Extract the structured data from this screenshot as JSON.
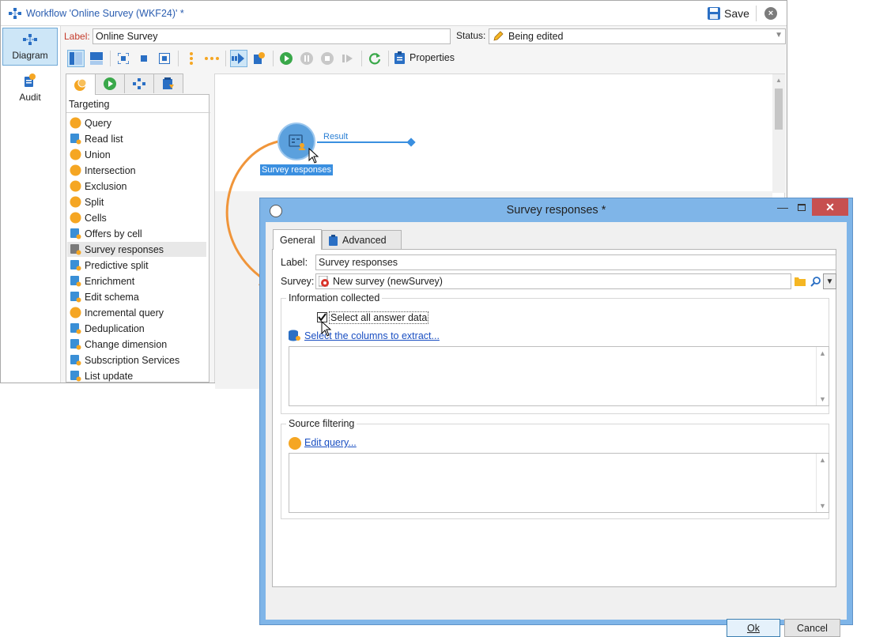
{
  "workflow": {
    "title": "Workflow 'Online Survey (WKF24)' *",
    "save_label": "Save",
    "label_caption": "Label:",
    "label_value": "Online Survey",
    "status_caption": "Status:",
    "status_value": "Being edited",
    "properties_label": "Properties"
  },
  "nav": {
    "diagram": "Diagram",
    "audit": "Audit"
  },
  "palette": {
    "header": "Targeting",
    "items": [
      {
        "label": "Query",
        "icon": "query-icon",
        "color": "#f5a623"
      },
      {
        "label": "Read list",
        "icon": "read-list-icon",
        "color": "#3a8fd6"
      },
      {
        "label": "Union",
        "icon": "union-icon",
        "color": "#f5a623"
      },
      {
        "label": "Intersection",
        "icon": "intersection-icon",
        "color": "#f5a623"
      },
      {
        "label": "Exclusion",
        "icon": "exclusion-icon",
        "color": "#f5a623"
      },
      {
        "label": "Split",
        "icon": "split-icon",
        "color": "#f5a623"
      },
      {
        "label": "Cells",
        "icon": "cells-icon",
        "color": "#f5a623"
      },
      {
        "label": "Offers by cell",
        "icon": "offers-by-cell-icon",
        "color": "#3a8fd6"
      },
      {
        "label": "Survey responses",
        "icon": "survey-responses-icon",
        "color": "#7a7a7a"
      },
      {
        "label": "Predictive split",
        "icon": "predictive-split-icon",
        "color": "#3a8fd6"
      },
      {
        "label": "Enrichment",
        "icon": "enrichment-icon",
        "color": "#3a8fd6"
      },
      {
        "label": "Edit schema",
        "icon": "edit-schema-icon",
        "color": "#3a8fd6"
      },
      {
        "label": "Incremental query",
        "icon": "incremental-query-icon",
        "color": "#f5a623"
      },
      {
        "label": "Deduplication",
        "icon": "deduplication-icon",
        "color": "#3a8fd6"
      },
      {
        "label": "Change dimension",
        "icon": "change-dimension-icon",
        "color": "#3a8fd6"
      },
      {
        "label": "Subscription Services",
        "icon": "subscription-services-icon",
        "color": "#3a8fd6"
      },
      {
        "label": "List update",
        "icon": "list-update-icon",
        "color": "#3a8fd6"
      }
    ]
  },
  "canvas": {
    "activity_label": "Survey responses",
    "transition_label": "Result"
  },
  "dialog": {
    "title": "Survey responses *",
    "tab_general": "General",
    "tab_advanced": "Advanced",
    "label_caption": "Label:",
    "label_value": "Survey responses",
    "survey_caption": "Survey:",
    "survey_value": "New survey (newSurvey)",
    "info_group": "Information collected",
    "select_all_label": "Select all answer data",
    "select_all_checked": true,
    "select_columns_link": "Select the columns to extract...",
    "source_group": "Source filtering",
    "edit_query_link": "Edit query...",
    "ok_label": "Ok",
    "cancel_label": "Cancel"
  },
  "colors": {
    "accent": "#3a8fe0",
    "orange": "#f0953a",
    "dialog_frame": "#7fb5e8",
    "close_red": "#c75050"
  }
}
